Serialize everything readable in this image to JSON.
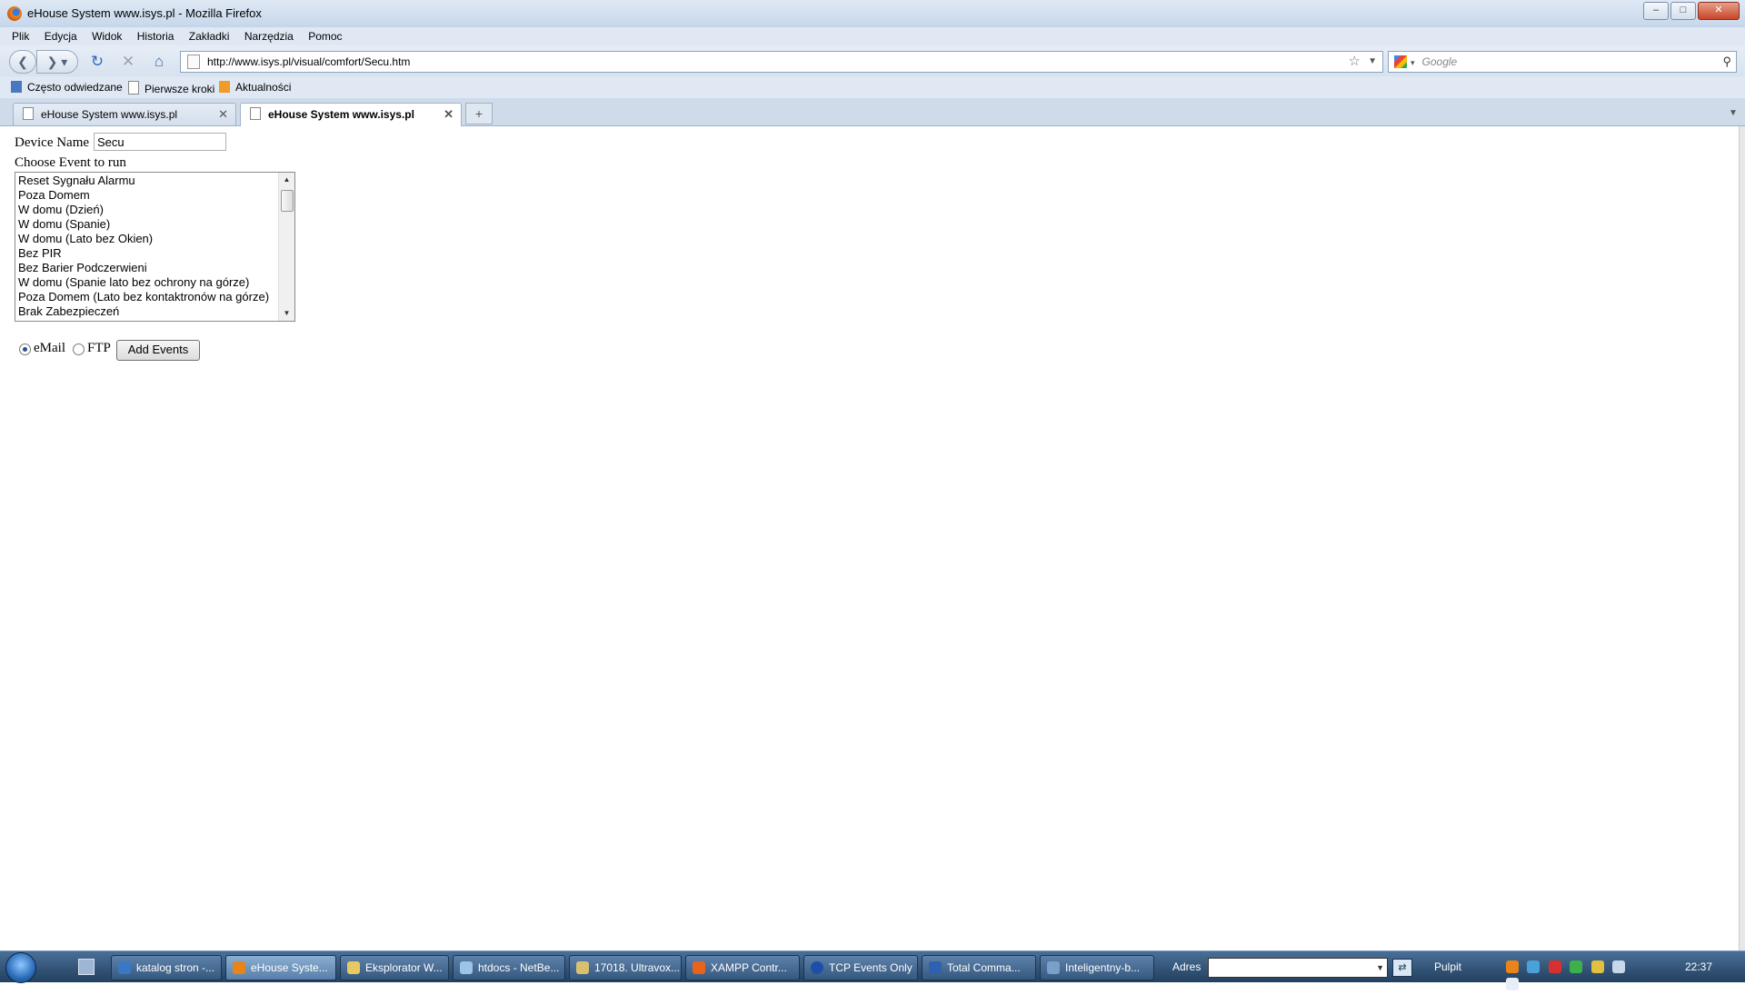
{
  "window": {
    "title": "eHouse System www.isys.pl - Mozilla Firefox"
  },
  "menu": [
    "Plik",
    "Edycja",
    "Widok",
    "Historia",
    "Zakładki",
    "Narzędzia",
    "Pomoc"
  ],
  "nav": {
    "url": "http://www.isys.pl/visual/comfort/Secu.htm",
    "search_placeholder": "Google"
  },
  "bookmarks": [
    "Często odwiedzane",
    "Pierwsze kroki",
    "Aktualności"
  ],
  "tabs": [
    "eHouse System www.isys.pl",
    "eHouse System www.isys.pl"
  ],
  "page": {
    "device_label": "Device Name",
    "device_value": "Secu",
    "event_label": "Choose Event to run",
    "events": [
      "Reset Sygnału Alarmu",
      "Poza Domem",
      "W domu (Dzień)",
      "W domu (Spanie)",
      "W domu (Lato bez Okien)",
      "Bez PIR",
      "Bez Barier Podczerwieni",
      "W domu (Spanie lato bez ochrony na górze)",
      "Poza Domem (Lato bez kontaktronów na górze)",
      "Brak Zabezpieczeń"
    ],
    "radio_email": "eMail",
    "radio_ftp": "FTP",
    "selected_radio": "eMail",
    "add_button": "Add Events"
  },
  "taskbar": {
    "tasks": [
      "katalog stron -...",
      "eHouse Syste...",
      "Eksplorator W...",
      "htdocs - NetBe...",
      "17018. Ultravox...",
      "XAMPP Contr...",
      "TCP Events Only",
      "Total Comma...",
      "Inteligentny-b..."
    ],
    "address_label": "Adres",
    "desktop_label": "Pulpit",
    "clock": "22:37"
  }
}
